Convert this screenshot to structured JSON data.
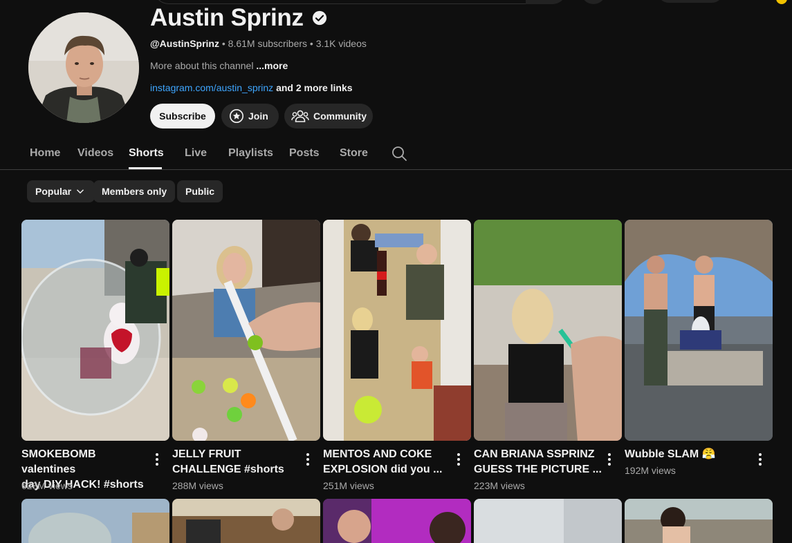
{
  "channel": {
    "name": "Austin Sprinz",
    "handle": "@AustinSprinz",
    "stats": " • 8.61M subscribers • 3.1K videos",
    "about": "More about this channel ",
    "about_more": "...more",
    "link": "instagram.com/austin_sprinz",
    "more_links": " and 2 more links"
  },
  "buttons": {
    "subscribe": "Subscribe",
    "join": "Join",
    "community": "Community"
  },
  "tabs": [
    "Home",
    "Videos",
    "Shorts",
    "Live",
    "Playlists",
    "Posts",
    "Store"
  ],
  "active_tab": "Shorts",
  "chips": {
    "popular": "Popular",
    "members_only": "Members only",
    "public": "Public"
  },
  "shorts": [
    {
      "title_line1": "SMOKEBOMB valentines",
      "title_line2": "day DIY HACK! #shorts",
      "views": "628M views"
    },
    {
      "title_line1": "JELLY FRUIT",
      "title_line2": "CHALLENGE #shorts",
      "views": "288M views"
    },
    {
      "title_line1": "MENTOS AND COKE",
      "title_line2": "EXPLOSION did you ...",
      "views": "251M views"
    },
    {
      "title_line1": "CAN BRIANA SSPRINZ",
      "title_line2": "GUESS THE PICTURE ...",
      "views": "223M views"
    },
    {
      "title_line1": "Wubble SLAM 😤",
      "title_line2": "",
      "views": "192M views"
    }
  ],
  "colors": {
    "background": "#0f0f0f",
    "chip": "#272727",
    "link": "#3ea6ff",
    "secondary_text": "#aaaaaa"
  }
}
